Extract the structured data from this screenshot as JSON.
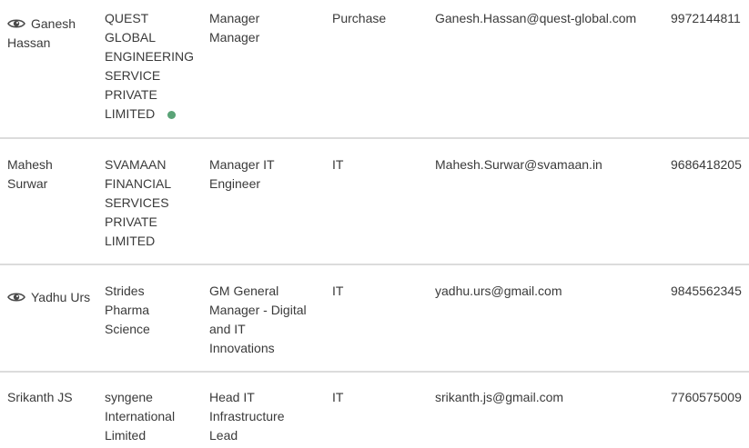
{
  "rows": [
    {
      "has_view_icon": true,
      "name": "Ganesh Hassan",
      "company": "QUEST GLOBAL ENGINEERING SERVICE PRIVATE LIMITED",
      "company_lines": [
        "QUEST",
        "GLOBAL",
        "ENGINEERING",
        "SERVICE",
        "PRIVATE",
        "LIMITED"
      ],
      "status_dot": true,
      "status_color": "#5aa377",
      "designation_lines": [
        "Manager",
        "Manager"
      ],
      "department": "Purchase",
      "email": "Ganesh.Hassan@quest-global.com",
      "phone": "9972144811"
    },
    {
      "has_view_icon": false,
      "name": "Mahesh Surwar",
      "company_lines": [
        "SVAMAAN",
        "FINANCIAL",
        "SERVICES",
        "PRIVATE",
        "LIMITED"
      ],
      "status_dot": false,
      "designation_lines": [
        "Manager IT",
        "Engineer"
      ],
      "department": "IT",
      "email": "Mahesh.Surwar@svamaan.in",
      "phone": "9686418205"
    },
    {
      "has_view_icon": true,
      "name": "Yadhu Urs",
      "company_lines": [
        "Strides",
        "Pharma",
        "Science"
      ],
      "status_dot": false,
      "designation_lines": [
        "GM General",
        "Manager - Digital",
        "and IT",
        "Innovations"
      ],
      "department": "IT",
      "email": "yadhu.urs@gmail.com",
      "phone": "9845562345"
    },
    {
      "has_view_icon": false,
      "name": "Srikanth JS",
      "company_lines": [
        "syngene",
        "International",
        "Limited"
      ],
      "status_dot": false,
      "designation_lines": [
        "Head IT",
        "Infrastructure",
        "Lead"
      ],
      "department": "IT",
      "email": "srikanth.js@gmail.com",
      "phone": "7760575009"
    }
  ],
  "icons": {
    "view": "eye-icon",
    "status": "status-dot-icon"
  },
  "colors": {
    "text": "#3a3a3a",
    "divider": "#dcdcdc",
    "status_green": "#5aa377"
  }
}
